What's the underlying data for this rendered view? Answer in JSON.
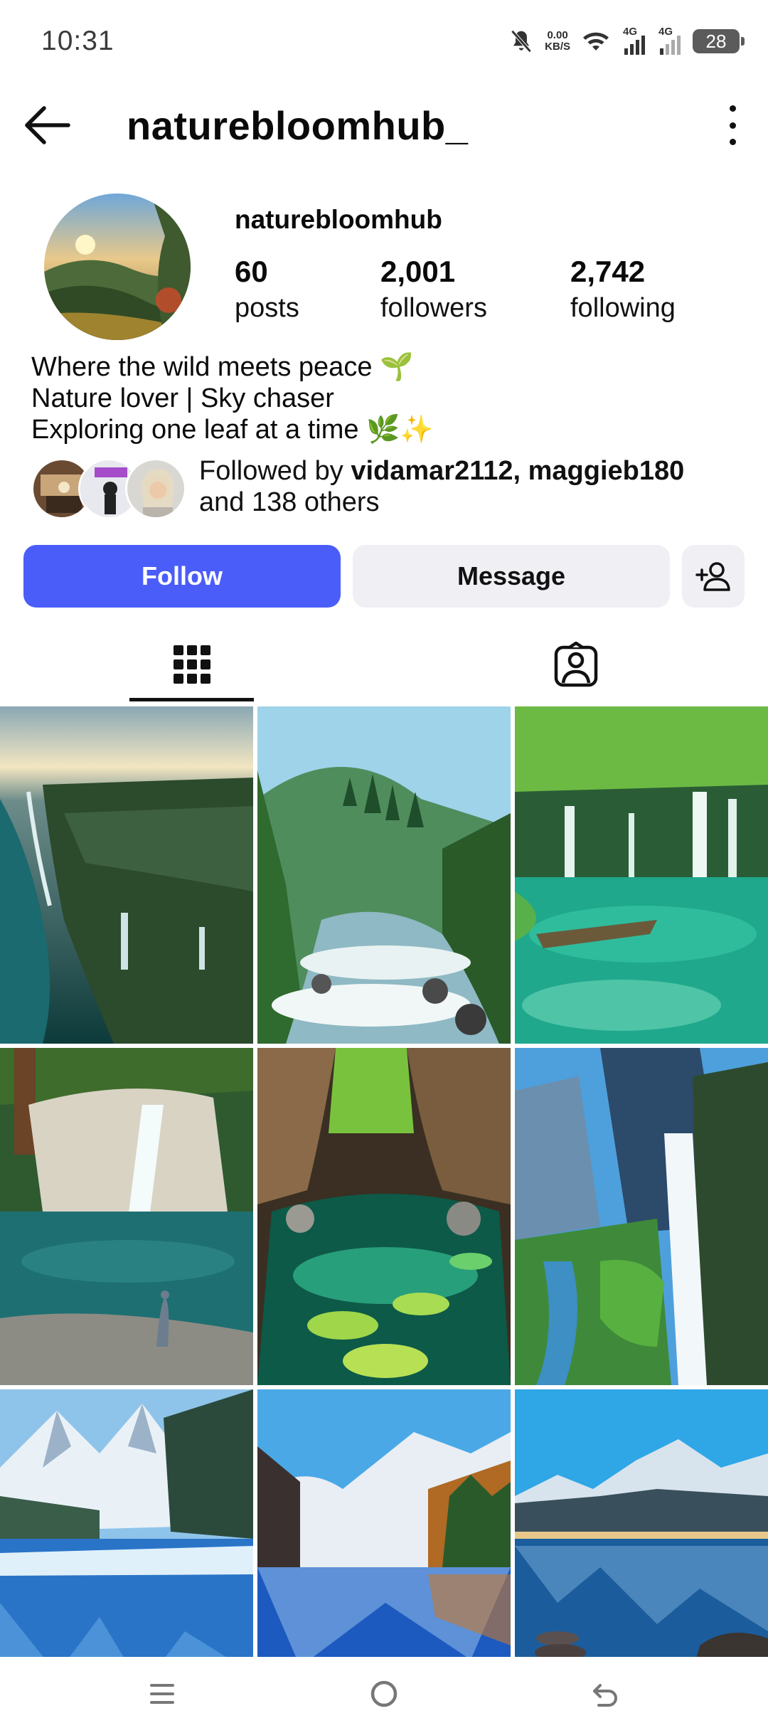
{
  "status_bar": {
    "time": "10:31",
    "net_speed_value": "0.00",
    "net_speed_unit": "KB/S",
    "signal1_label": "4G",
    "signal2_label": "4G",
    "battery": "28"
  },
  "header": {
    "title": "naturebloomhub_"
  },
  "profile": {
    "username": "naturebloomhub",
    "stats": {
      "posts": {
        "value": "60",
        "label": "posts"
      },
      "followers": {
        "value": "2,001",
        "label": "followers"
      },
      "following": {
        "value": "2,742",
        "label": "following"
      }
    },
    "bio": [
      "Where the wild meets peace 🌱",
      "Nature lover | Sky chaser",
      "Exploring one leaf at a time 🌿✨"
    ],
    "mutual": {
      "prefix": "Followed by ",
      "names": "vidamar2112, maggieb180",
      "suffix": "and 138 others"
    }
  },
  "actions": {
    "follow": "Follow",
    "message": "Message"
  },
  "colors": {
    "accent": "#4a5df9",
    "secondary_button": "#efeff4"
  },
  "icons": {
    "back": "arrow-left-icon",
    "more": "more-vertical-icon",
    "add_user": "add-user-icon",
    "grid_tab": "grid-icon",
    "tagged_tab": "tagged-person-icon",
    "nav_menu": "menu-icon",
    "nav_home": "home-circle-icon",
    "nav_back": "back-gesture-icon"
  }
}
